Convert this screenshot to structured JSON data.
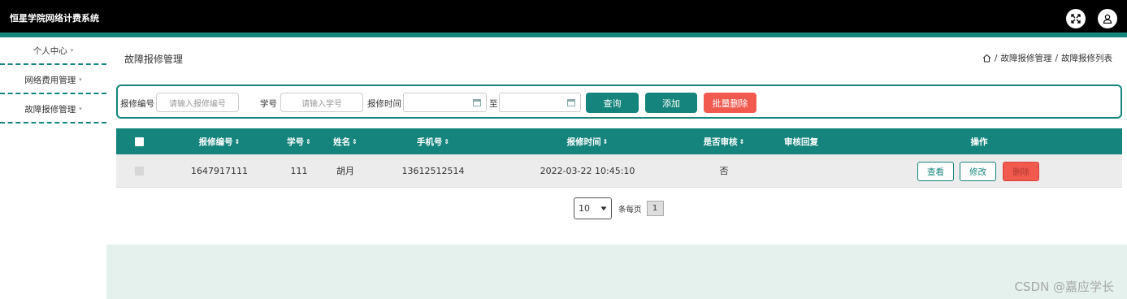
{
  "app": {
    "title": "恒星学院网络计费系统"
  },
  "header_icons": {
    "fullscreen": "fullscreen-icon",
    "user": "user-icon"
  },
  "sidebar": {
    "items": [
      {
        "label": "个人中心"
      },
      {
        "label": "网络费用管理"
      },
      {
        "label": "故障报修管理"
      }
    ],
    "caret": "▾"
  },
  "page": {
    "title": "故障报修管理",
    "breadcrumb": {
      "sep1": "/",
      "item1": "故障报修管理",
      "sep2": "/",
      "item2": "故障报修列表"
    }
  },
  "search": {
    "repair_no_label": "报修编号",
    "repair_no_placeholder": "请输入报修编号",
    "student_no_label": "学号",
    "student_no_placeholder": "请输入学号",
    "time_label": "报修时间",
    "to_label": "至",
    "query_button": "查询",
    "add_button": "添加",
    "batch_delete_button": "批量删除"
  },
  "table": {
    "columns": [
      "报修编号",
      "学号",
      "姓名",
      "手机号",
      "报修时间",
      "是否审核",
      "审核回复",
      "操作"
    ],
    "sort_glyph": "⇕",
    "rows": [
      {
        "repair_no": "1647917111",
        "student_no": "111",
        "name": "胡月",
        "phone": "13612512514",
        "time": "2022-03-22 10:45:10",
        "reviewed": "否",
        "reply": "",
        "actions": {
          "view": "查看",
          "edit": "修改",
          "delete": "删除"
        }
      }
    ]
  },
  "pagination": {
    "page_size": "10",
    "per_page_label": "条每页",
    "current_page": "1"
  },
  "watermark": "CSDN @嘉应学长",
  "colors": {
    "accent": "#15847c",
    "danger": "#f25a4f",
    "topbar": "#000000"
  }
}
